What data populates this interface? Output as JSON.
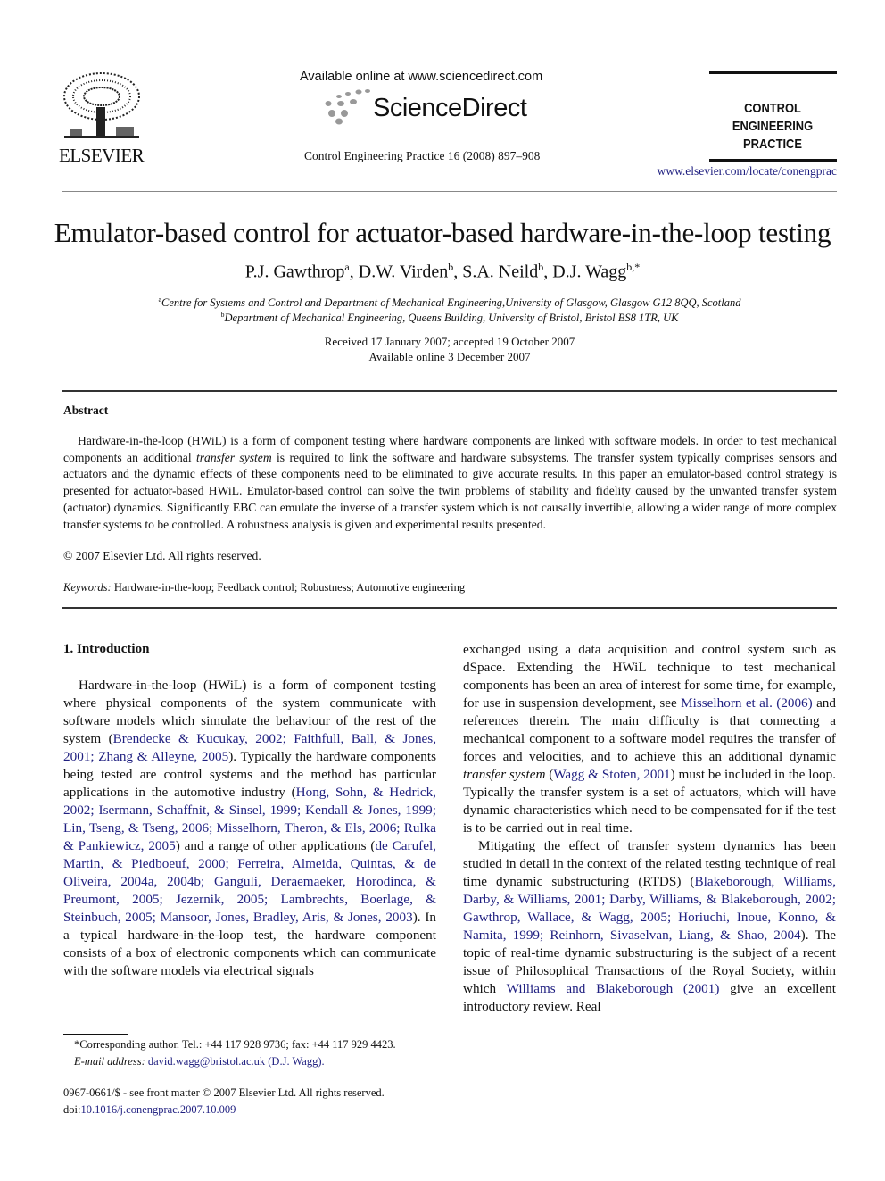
{
  "header": {
    "publisher_name": "ELSEVIER",
    "available_online": "Available online at www.sciencedirect.com",
    "sciencedirect_label": "ScienceDirect",
    "journal_reference": "Control Engineering Practice 16 (2008) 897–908",
    "journal_title_line1": "CONTROL ENGINEERING",
    "journal_title_line2": "PRACTICE",
    "journal_url": "www.elsevier.com/locate/conengprac"
  },
  "article": {
    "title": "Emulator-based control for actuator-based hardware-in-the-loop testing",
    "authors": [
      {
        "name": "P.J. Gawthrop",
        "sup": "a"
      },
      {
        "name": "D.W. Virden",
        "sup": "b"
      },
      {
        "name": "S.A. Neild",
        "sup": "b"
      },
      {
        "name": "D.J. Wagg",
        "sup": "b,*"
      }
    ],
    "affiliations": [
      {
        "sup": "a",
        "text": "Centre for Systems and Control and Department of Mechanical Engineering,University of Glasgow, Glasgow G12 8QQ, Scotland"
      },
      {
        "sup": "b",
        "text": "Department of Mechanical Engineering, Queens Building, University of Bristol, Bristol BS8 1TR, UK"
      }
    ],
    "received": "Received 17 January 2007; accepted 19 October 2007",
    "available": "Available online 3 December 2007"
  },
  "abstract": {
    "heading": "Abstract",
    "text_1": "Hardware-in-the-loop (HWiL) is a form of component testing where hardware components are linked with software models. In order to test mechanical components an additional ",
    "text_italic": "transfer system",
    "text_2": " is required to link the software and hardware subsystems. The transfer system typically comprises sensors and actuators and the dynamic effects of these components need to be eliminated to give accurate results. In this paper an emulator-based control strategy is presented for actuator-based HWiL. Emulator-based control can solve the twin problems of stability and fidelity caused by the unwanted transfer system (actuator) dynamics. Significantly EBC can emulate the inverse of a transfer system which is not causally invertible, allowing a wider range of more complex transfer systems to be controlled. A robustness analysis is given and experimental results presented.",
    "copyright": "© 2007 Elsevier Ltd. All rights reserved.",
    "keywords_label": "Keywords:",
    "keywords": "Hardware-in-the-loop; Feedback control; Robustness; Automotive engineering"
  },
  "intro": {
    "heading": "1.  Introduction",
    "left": {
      "t1": "Hardware-in-the-loop (HWiL) is a form of component testing where physical components of the system communicate with software models which simulate the behaviour of the rest of the system (",
      "c1": "Brendecke & Kucukay, 2002; Faithfull, Ball, & Jones, 2001; Zhang & Alleyne, 2005",
      "t2": "). Typically the hardware components being tested are control systems and the method has particular applications in the automotive industry (",
      "c2": "Hong, Sohn, & Hedrick, 2002; Isermann, Schaffnit, & Sinsel, 1999; Kendall & Jones, 1999; Lin, Tseng, & Tseng, 2006; Misselhorn, Theron, & Els, 2006; Rulka & Pankiewicz, 2005",
      "t3": ") and a range of other applications (",
      "c3": "de Carufel, Martin, & Piedboeuf, 2000; Ferreira, Almeida, Quintas, & de Oliveira, 2004a, 2004b; Ganguli, Deraemaeker, Horodinca, & Preumont, 2005; Jezernik, 2005; Lambrechts, Boerlage, & Steinbuch, 2005; Mansoor, Jones, Bradley, Aris, & Jones, 2003",
      "t4": "). In a typical hardware-in-the-loop test, the hardware component consists of a box of electronic components which can communicate with the software models via electrical signals"
    },
    "right": {
      "p1_t1": "exchanged using a data acquisition and control system such as dSpace. Extending the HWiL technique to test mechanical components has been an area of interest for some time, for example, for use in suspension development, see ",
      "p1_c1": "Misselhorn et al. (2006)",
      "p1_t2": " and references therein. The main difficulty is that connecting a mechanical component to a software model requires the transfer of forces and velocities, and to achieve this an additional dynamic ",
      "p1_italic": "transfer system",
      "p1_t3": " (",
      "p1_c2": "Wagg & Stoten, 2001",
      "p1_t4": ") must be included in the loop. Typically the transfer system is a set of actuators, which will have dynamic characteristics which need to be compensated for if the test is to be carried out in real time.",
      "p2_t1": "Mitigating the effect of transfer system dynamics has been studied in detail in the context of the related testing technique of real time dynamic substructuring (RTDS) (",
      "p2_c1": "Blakeborough, Williams, Darby, & Williams, 2001; Darby, Williams, & Blakeborough, 2002; Gawthrop, Wallace, & Wagg, 2005; Horiuchi, Inoue, Konno, & Namita, 1999; Reinhorn, Sivaselvan, Liang, & Shao, 2004",
      "p2_t2": "). The topic of real-time dynamic substructuring is the subject of a recent issue of Philosophical Transactions of the Royal Society, within which ",
      "p2_c2": "Williams and Blakeborough (2001)",
      "p2_t3": " give an excellent introductory review. Real"
    }
  },
  "footnotes": {
    "corresponding": "*Corresponding author. Tel.: +44 117 928 9736; fax: +44 117 929 4423.",
    "email_label": "E-mail address:",
    "email": "david.wagg@bristol.ac.uk (D.J. Wagg).",
    "front_matter": "0967-0661/$ - see front matter © 2007 Elsevier Ltd. All rights reserved.",
    "doi_label": "doi:",
    "doi": "10.1016/j.conengprac.2007.10.009"
  },
  "colors": {
    "link": "#1f1f80",
    "text": "#111111"
  }
}
